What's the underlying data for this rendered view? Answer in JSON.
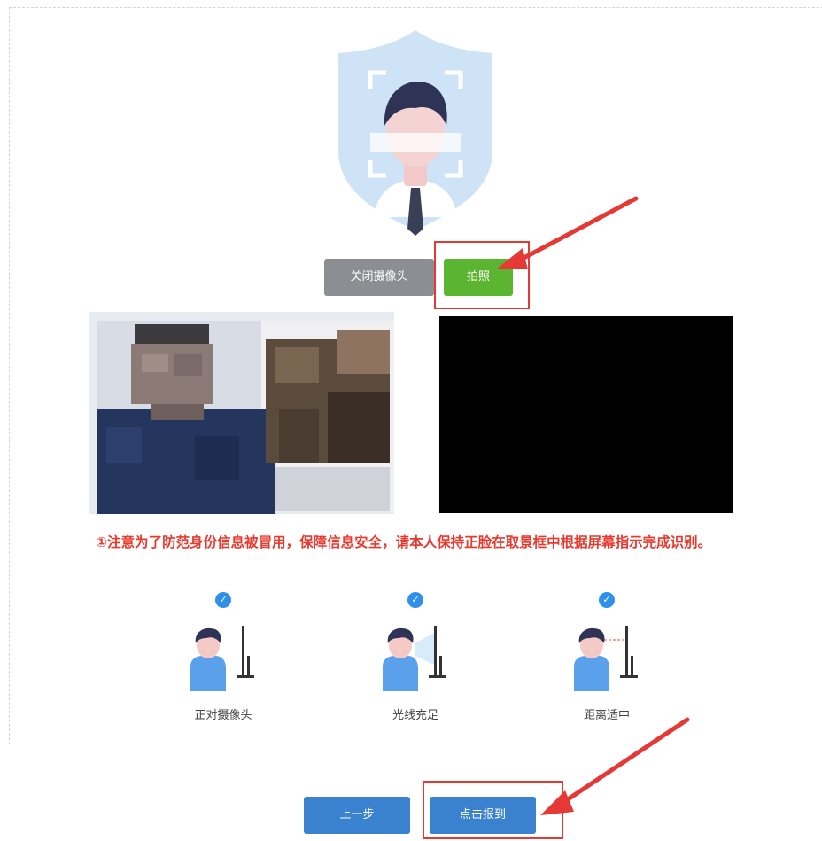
{
  "controls": {
    "close_camera_label": "关闭摄像头",
    "take_photo_label": "拍照"
  },
  "notice": {
    "text": "①注意为了防范身份信息被冒用，保障信息安全，请本人保持正脸在取景框中根据屏幕指示完成识别。"
  },
  "tips": [
    {
      "label": "正对摄像头",
      "icon": "face-camera-icon"
    },
    {
      "label": "光线充足",
      "icon": "good-lighting-icon"
    },
    {
      "label": "距离适中",
      "icon": "proper-distance-icon"
    }
  ],
  "footer": {
    "prev_label": "上一步",
    "submit_label": "点击报到"
  },
  "colors": {
    "accent_blue": "#3a82d0",
    "green": "#5cb531",
    "gray_button": "#8b8f94",
    "warning_red": "#e8392e"
  }
}
